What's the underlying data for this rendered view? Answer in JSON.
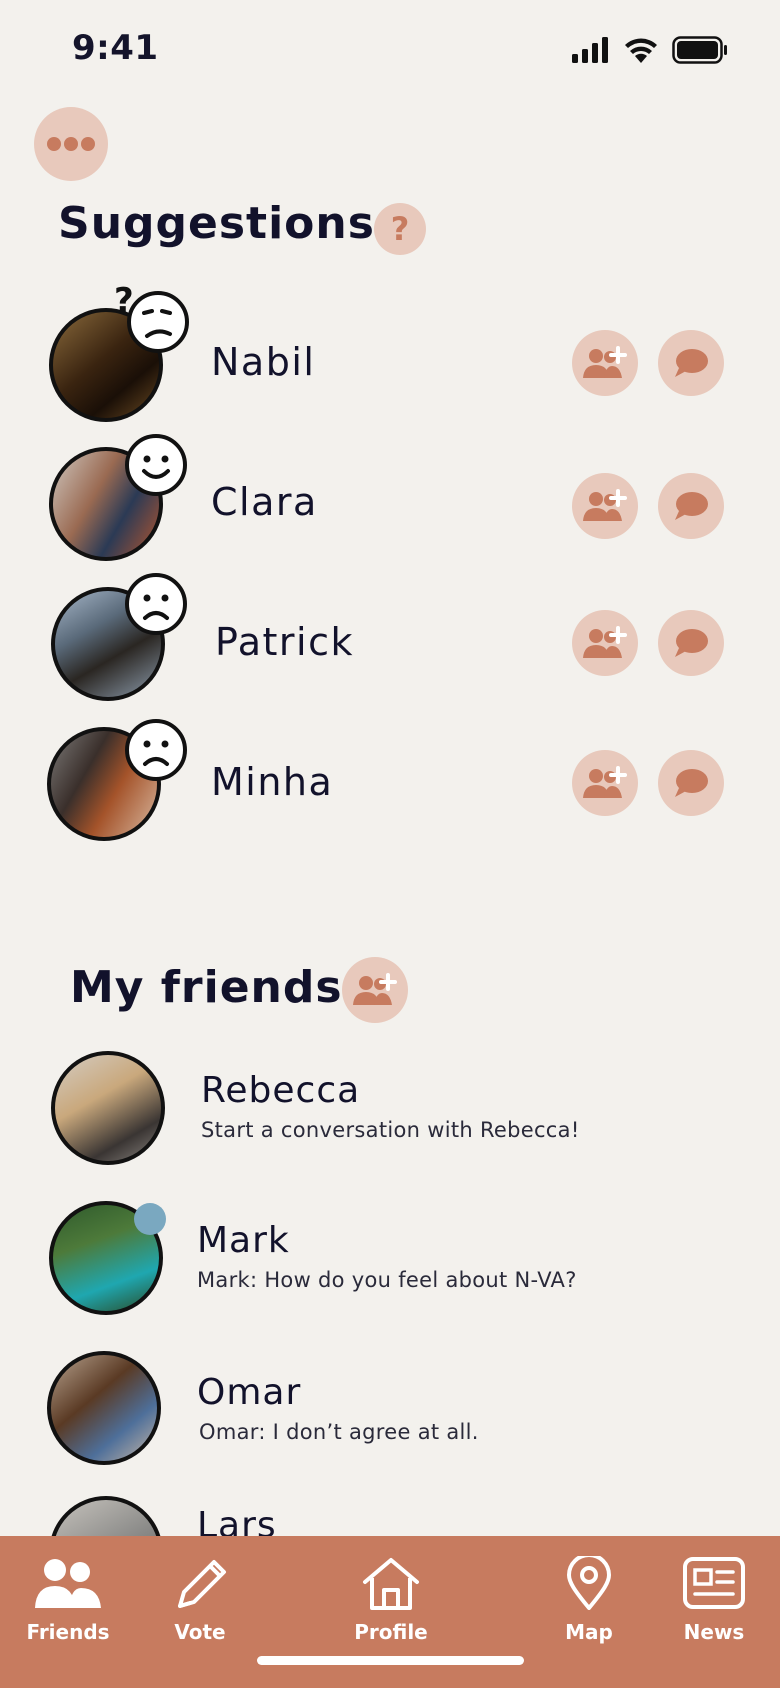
{
  "status": {
    "time": "9:41"
  },
  "suggestions": {
    "title": "Suggestions",
    "items": [
      {
        "name": "Nabil",
        "mood": "confused-face-icon"
      },
      {
        "name": "Clara",
        "mood": "smile-face-icon"
      },
      {
        "name": "Patrick",
        "mood": "frown-face-icon"
      },
      {
        "name": "Minha",
        "mood": "frown-face-icon"
      }
    ]
  },
  "friends": {
    "title": "My friends",
    "items": [
      {
        "name": "Rebecca",
        "message": "Start a conversation with Rebecca!"
      },
      {
        "name": "Mark",
        "message": "Mark: How do you feel about N-VA?",
        "unread": true
      },
      {
        "name": "Omar",
        "message": "Omar: I don’t agree at all."
      },
      {
        "name": "Lars",
        "message": ""
      }
    ]
  },
  "nav": {
    "items": [
      {
        "label": "Friends",
        "icon": "friends-icon"
      },
      {
        "label": "Vote",
        "icon": "pencil-icon"
      },
      {
        "label": "Profile",
        "icon": "home-icon"
      },
      {
        "label": "Map",
        "icon": "map-pin-icon"
      },
      {
        "label": "News",
        "icon": "news-icon"
      }
    ]
  },
  "colors": {
    "background": "#f3f1ed",
    "accent": "#c77b5f",
    "accent_light": "#e8c9bc",
    "text": "#12122b",
    "unread_dot": "#7aa8c0"
  }
}
